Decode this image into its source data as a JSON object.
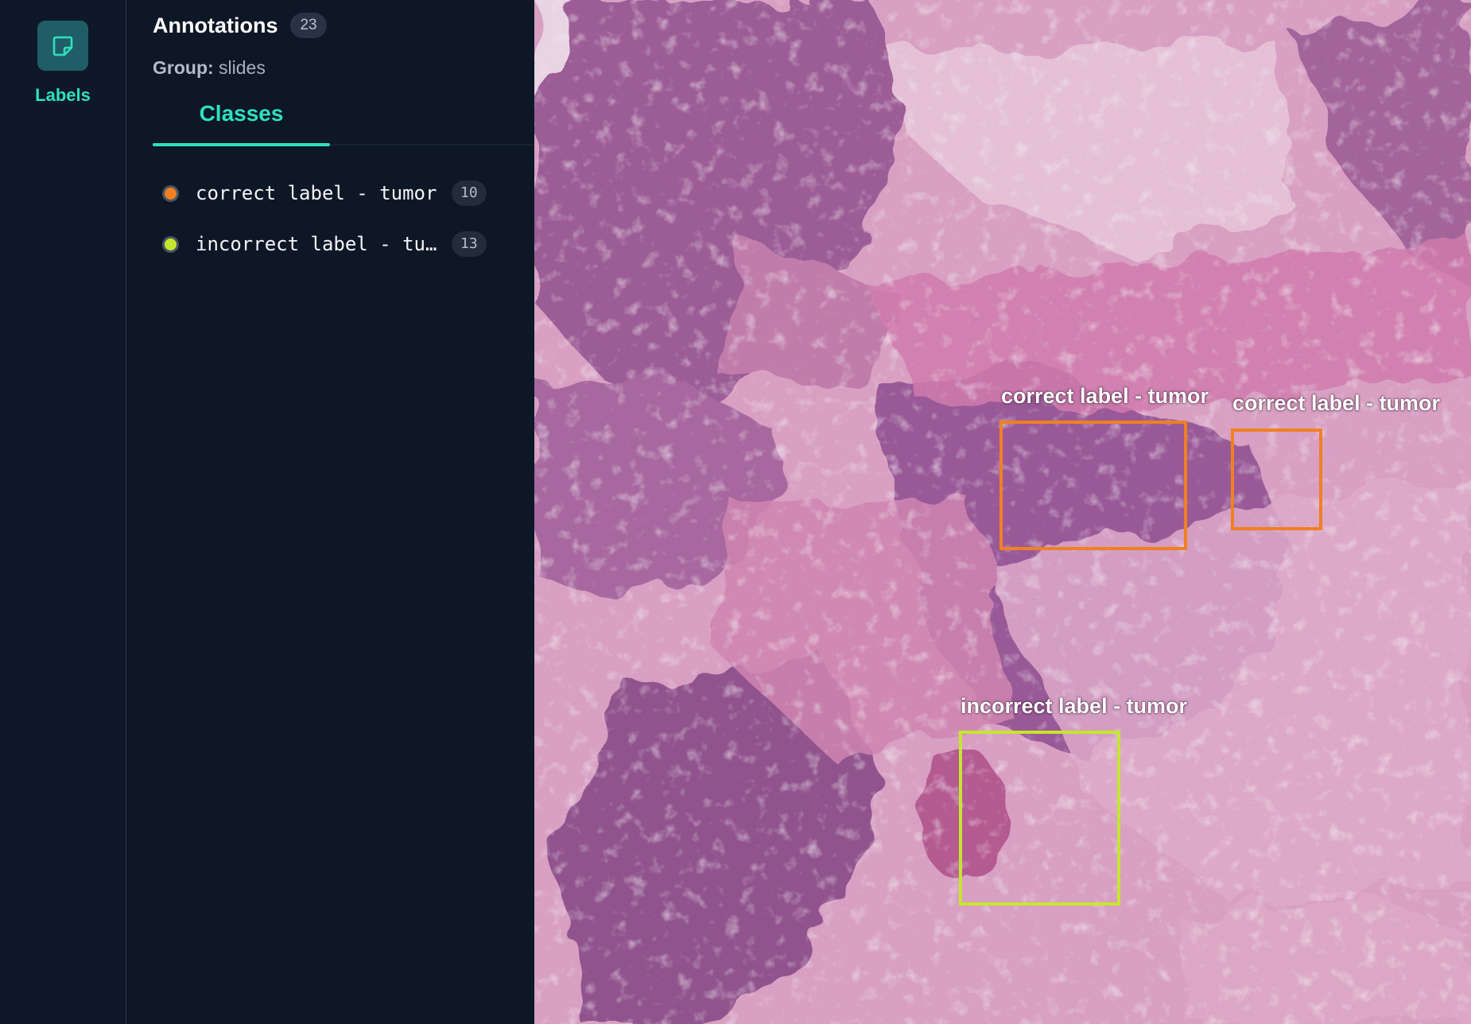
{
  "sidebar": {
    "rail_item": {
      "label": "Labels",
      "icon": "note-icon"
    }
  },
  "panel": {
    "title": "Annotations",
    "total_count": "23",
    "group_key": "Group:",
    "group_value": "slides",
    "tab": "Classes",
    "classes": [
      {
        "name": "correct label - tumor",
        "count": "10",
        "color": "#f08021"
      },
      {
        "name": "incorrect label - tumor",
        "count": "13",
        "color": "#c6e62e"
      }
    ]
  },
  "viewer": {
    "annotations": [
      {
        "label": "correct label - tumor",
        "color": "#f08021"
      },
      {
        "label": "correct label - tumor",
        "color": "#f08021"
      },
      {
        "label": "incorrect label - tumor",
        "color": "#c6e62e"
      }
    ]
  },
  "colors": {
    "accent": "#2fe0c0",
    "background": "#0e1726"
  }
}
